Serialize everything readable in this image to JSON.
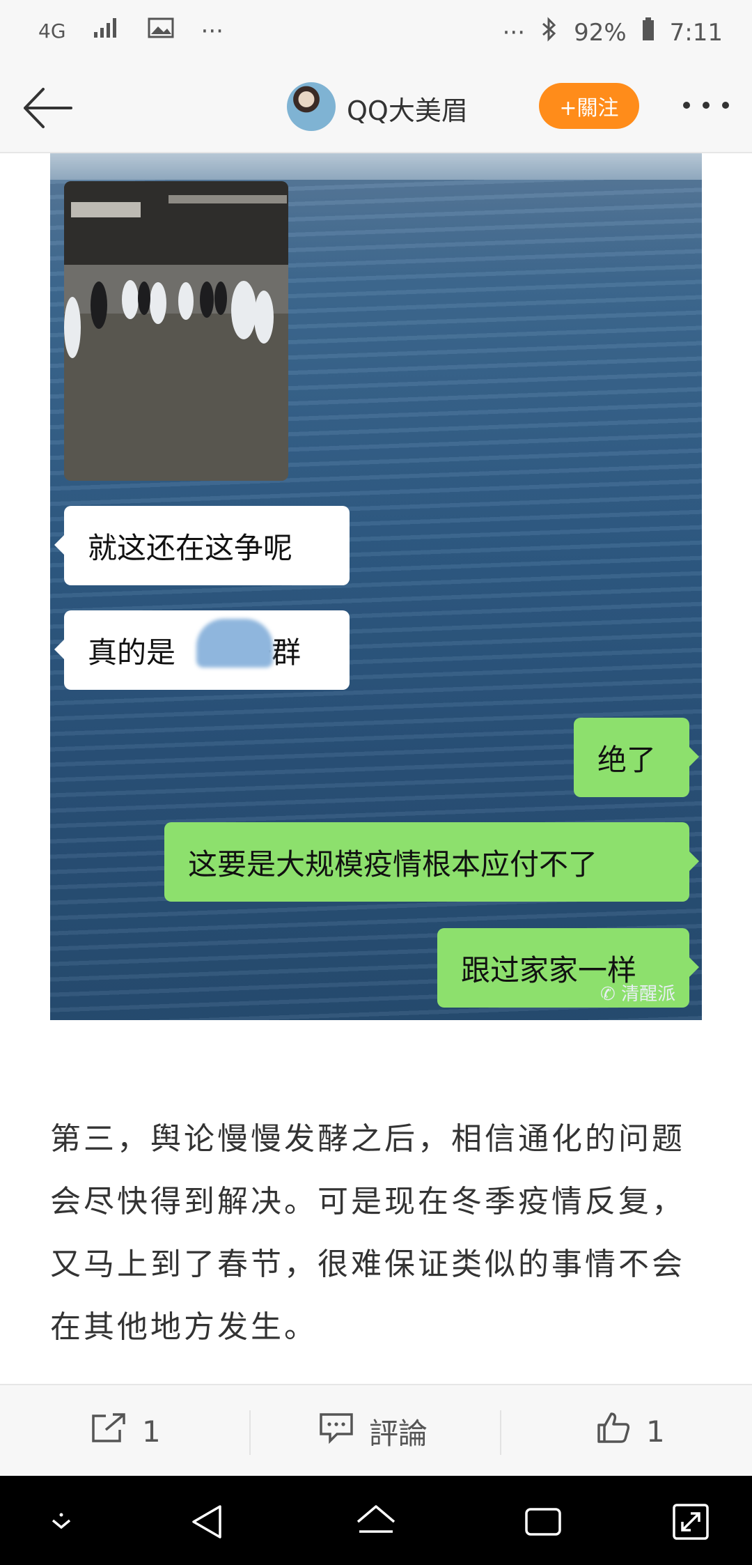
{
  "status_bar": {
    "network": "4G",
    "more_left": "···",
    "more_right": "···",
    "battery": "92%",
    "time": "7:11"
  },
  "header": {
    "username": "QQ大美眉",
    "follow_label": "+關注"
  },
  "photo": {
    "messages": [
      {
        "side": "left",
        "text": "就这还在这争呢"
      },
      {
        "side": "left",
        "text": "真的是",
        "text_after_blur": "一群"
      },
      {
        "side": "right",
        "text": "绝了"
      },
      {
        "side": "right",
        "text": "这要是大规模疫情根本应付不了"
      },
      {
        "side": "right",
        "text": "跟过家家一样"
      }
    ],
    "watermark": "清醒派"
  },
  "article": {
    "paragraph": "第三，舆论慢慢发酵之后，相信通化的问题会尽快得到解决。可是现在冬季疫情反复，又马上到了春节，很难保证类似的事情不会在其他地方发生。"
  },
  "action_bar": {
    "share_count": "1",
    "comment_label": "評論",
    "like_count": "1"
  }
}
